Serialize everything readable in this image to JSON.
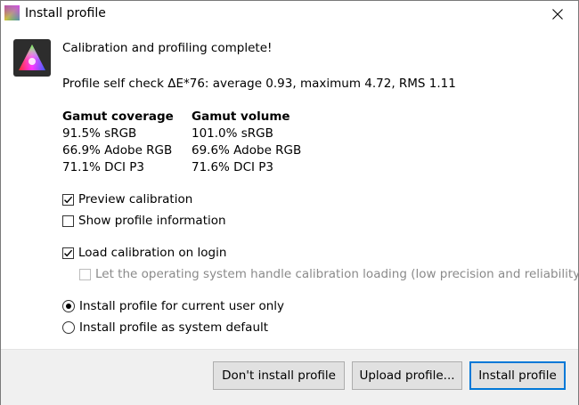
{
  "window": {
    "title": "Install profile"
  },
  "heading": "Calibration and profiling complete!",
  "self_check": "Profile self check ΔE*76: average 0.93, maximum 4.72, RMS 1.11",
  "gamut_coverage": {
    "title": "Gamut coverage",
    "rows": [
      "91.5% sRGB",
      "66.9% Adobe RGB",
      "71.1% DCI P3"
    ]
  },
  "gamut_volume": {
    "title": "Gamut volume",
    "rows": [
      "101.0% sRGB",
      "69.6% Adobe RGB",
      "71.6% DCI P3"
    ]
  },
  "options": {
    "preview_calibration": {
      "label": "Preview calibration",
      "checked": true
    },
    "show_profile_info": {
      "label": "Show profile information",
      "checked": false
    },
    "load_on_login": {
      "label": "Load calibration on login",
      "checked": true
    },
    "os_handle": {
      "label": "Let the operating system handle calibration loading (low precision and reliability)",
      "checked": false,
      "enabled": false
    }
  },
  "install_scope": {
    "current_user": {
      "label": "Install profile for current user only",
      "selected": true
    },
    "system_default": {
      "label": "Install profile as system default",
      "selected": false
    }
  },
  "buttons": {
    "dont_install": "Don't install profile",
    "upload": "Upload profile...",
    "install": "Install profile"
  },
  "icons": {
    "app": "displaycal-icon",
    "profile": "gamut-triangle-icon",
    "close": "close-icon"
  },
  "colors": {
    "accent": "#0078d7",
    "button_bg": "#e1e1e1"
  }
}
